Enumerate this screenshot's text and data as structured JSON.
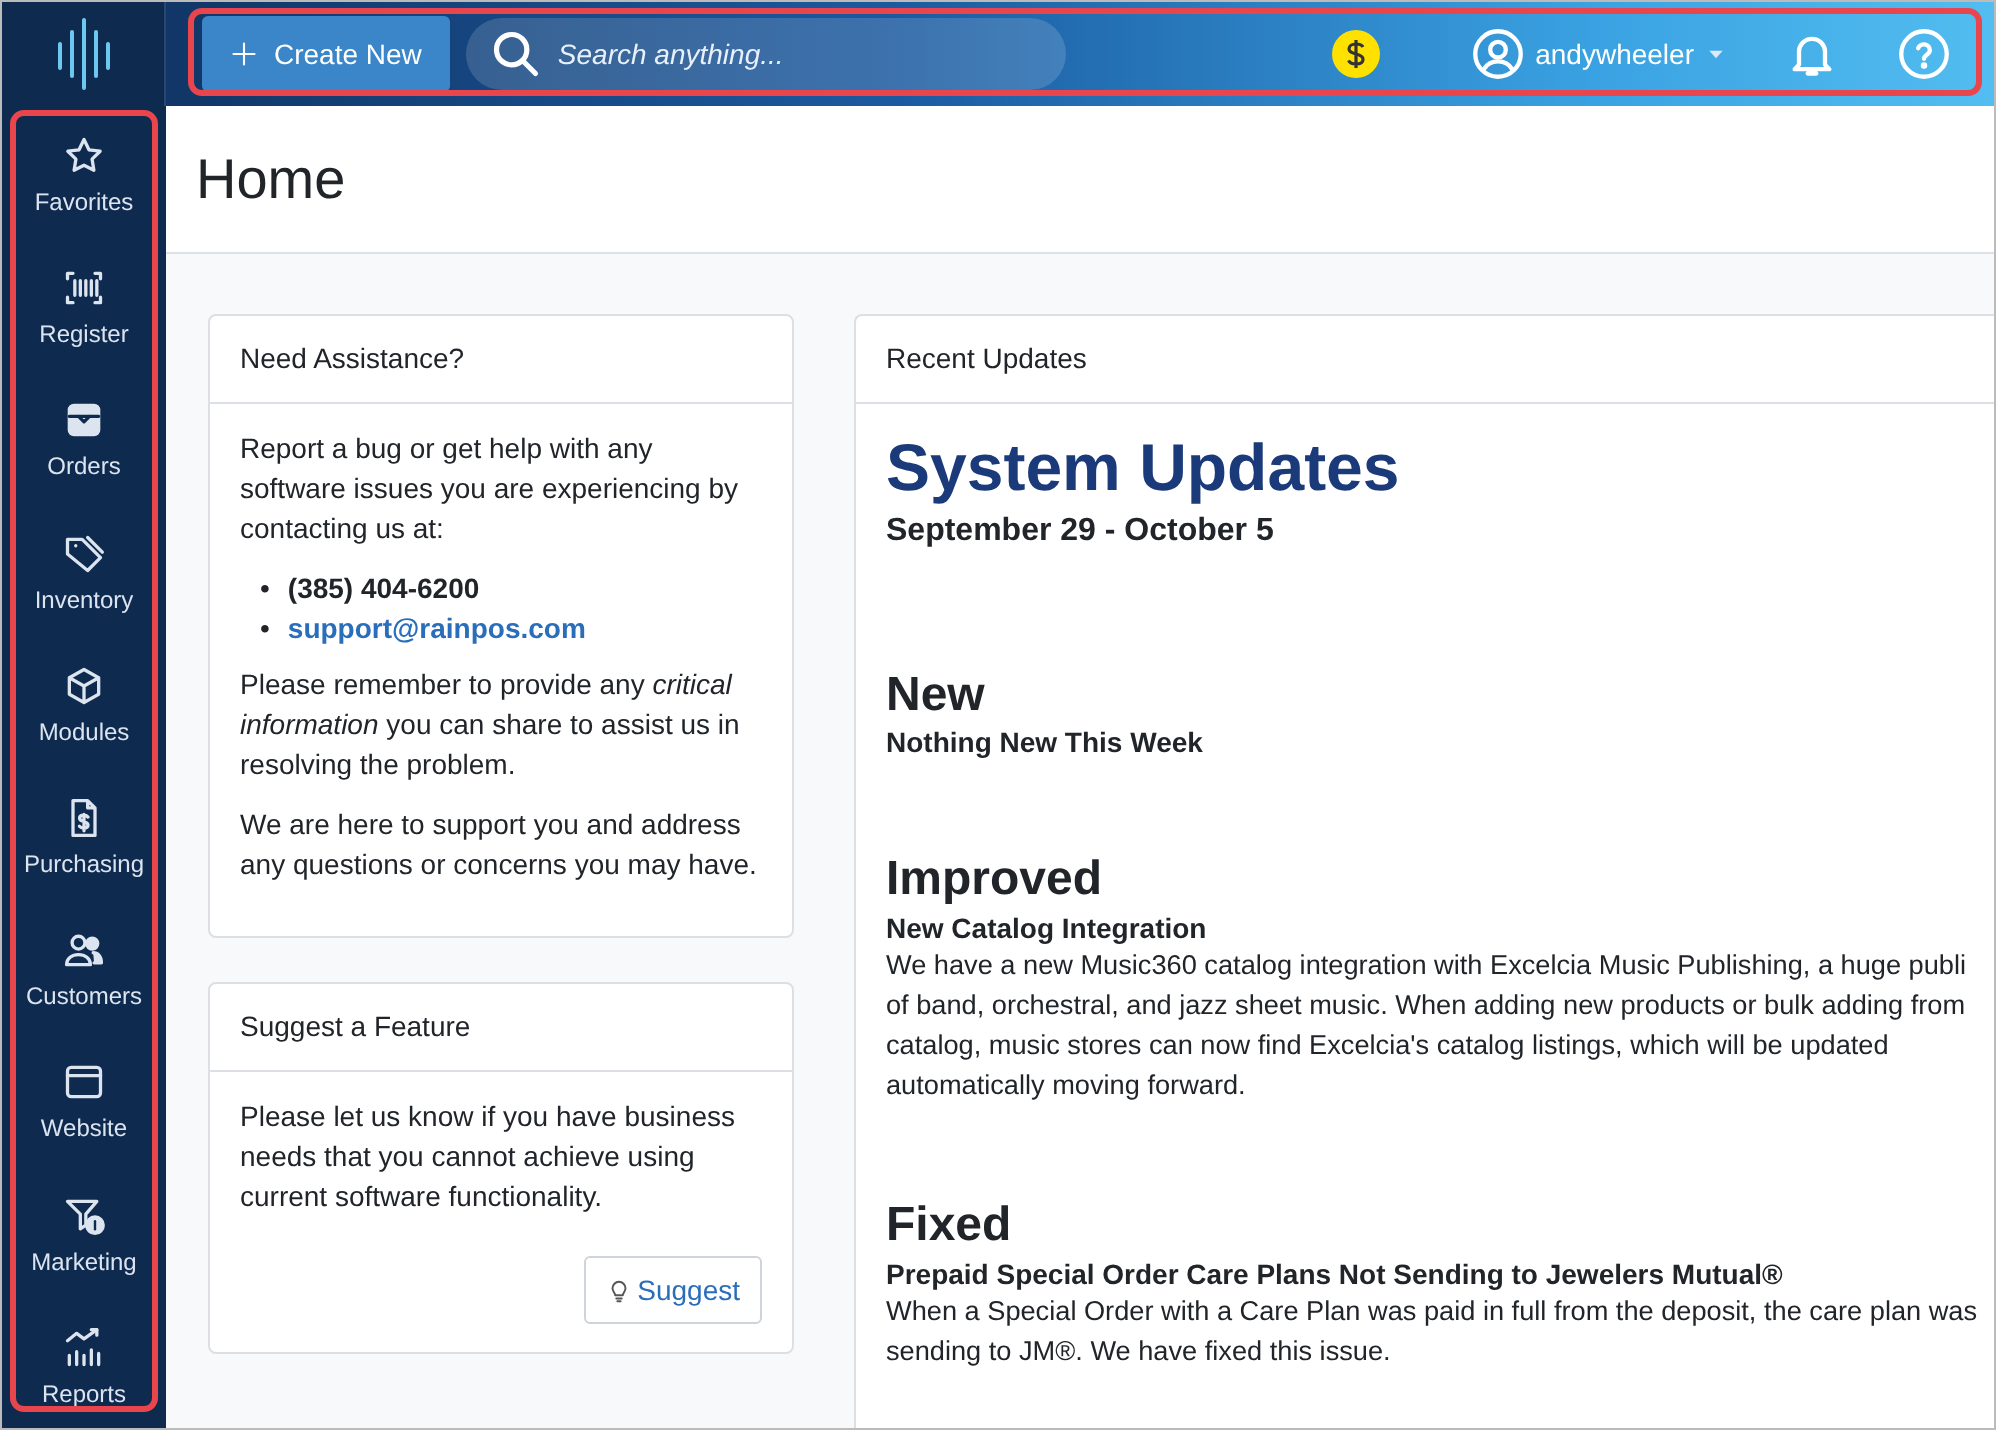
{
  "topbar": {
    "create_button": "Create New",
    "search": {
      "placeholder": "Search anything..."
    },
    "user": "andywheeler"
  },
  "sidebar": {
    "items": [
      {
        "label": "Favorites"
      },
      {
        "label": "Register"
      },
      {
        "label": "Orders"
      },
      {
        "label": "Inventory"
      },
      {
        "label": "Modules"
      },
      {
        "label": "Purchasing"
      },
      {
        "label": "Customers"
      },
      {
        "label": "Website"
      },
      {
        "label": "Marketing"
      },
      {
        "label": "Reports"
      }
    ]
  },
  "page_title": "Home",
  "assistance_card": {
    "title": "Need Assistance?",
    "intro": "Report a bug or get help with any software issues you are experiencing by contacting us at:",
    "contacts": [
      {
        "kind": "phone",
        "marker": "•",
        "text": "(385) 404-6200"
      },
      {
        "kind": "email",
        "marker": "•",
        "text": "support@rainpos.com"
      }
    ],
    "reminder": "Please remember to provide any *critical information* you can share to assist us in resolving the problem.",
    "support_note": "We are here to support you and address any questions or concerns you may have."
  },
  "suggest_card": {
    "title": "Suggest a Feature",
    "text": "Please let us know if you have business needs that you cannot achieve using current software functionality.",
    "button": "Suggest"
  },
  "updates_card": {
    "title": "Recent Updates",
    "heading": "System Updates",
    "date_range": "September 29 - October 5",
    "sections": [
      {
        "heading": "New",
        "items": [
          {
            "title": "Nothing New This Week"
          }
        ]
      },
      {
        "heading": "Improved",
        "items": [
          {
            "title": "New Catalog Integration",
            "lines": [
              "We have a new Music360 catalog integration with Excelcia Music Publishing, a huge publi",
              "of band, orchestral, and jazz sheet music. When adding new products or bulk adding from",
              "catalog, music stores can now find Excelcia's catalog listings, which will be updated",
              "automatically moving forward."
            ]
          }
        ]
      },
      {
        "heading": "Fixed",
        "items": [
          {
            "title": "Prepaid Special Order Care Plans Not Sending to Jewelers Mutual®",
            "lines": [
              "When a Special Order with a Care Plan was paid in full from the deposit, the care plan was",
              "sending to JM®. We have fixed this issue."
            ]
          }
        ]
      }
    ]
  }
}
